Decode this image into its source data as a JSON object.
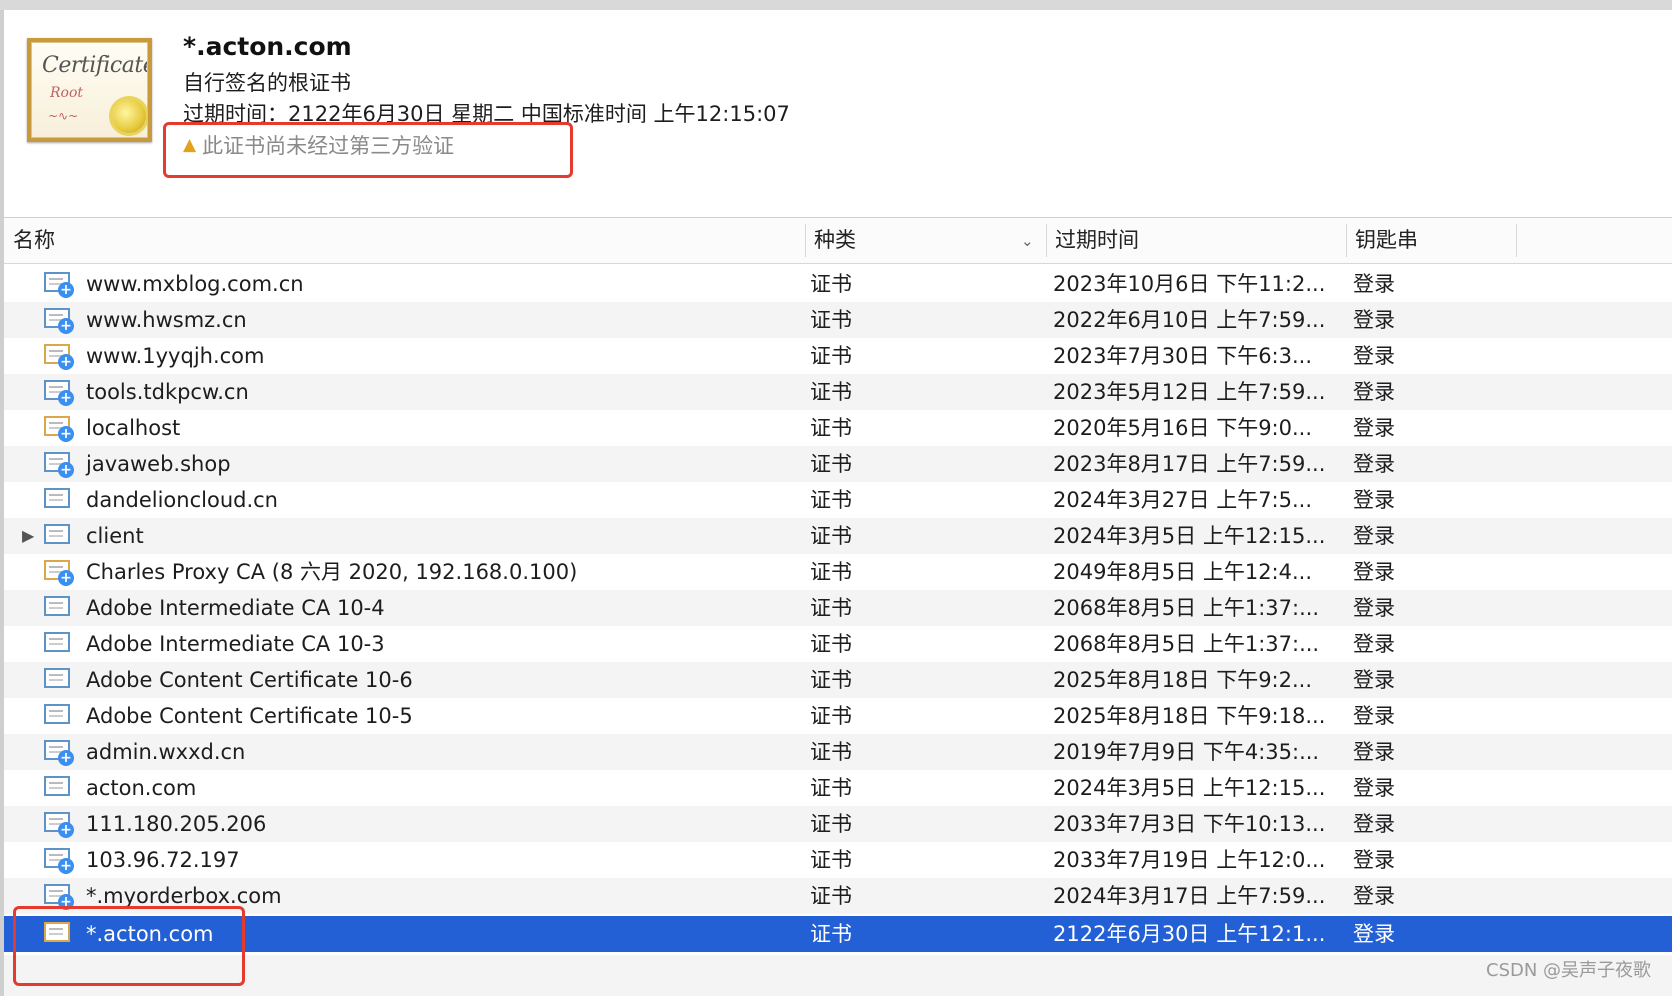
{
  "header": {
    "title": "*.acton.com",
    "subtitle": "自行签名的根证书",
    "expiry": "过期时间：2122年6月30日 星期二 中国标准时间 上午12:15:07",
    "warning": "此证书尚未经过第三方验证",
    "icon_text1": "Certificate",
    "icon_text2": "Root"
  },
  "columns": {
    "name": "名称",
    "kind": "种类",
    "expires": "过期时间",
    "keychain": "钥匙串"
  },
  "rows": [
    {
      "name": "www.mxblog.com.cn",
      "kind": "证书",
      "expires": "2023年10月6日 下午11:2...",
      "keychain": "登录"
    },
    {
      "name": "www.hwsmz.cn",
      "kind": "证书",
      "expires": "2022年6月10日 上午7:59...",
      "keychain": "登录"
    },
    {
      "name": "www.1yyqjh.com",
      "kind": "证书",
      "expires": "2023年7月30日 下午6:3...",
      "keychain": "登录"
    },
    {
      "name": "tools.tdkpcw.cn",
      "kind": "证书",
      "expires": "2023年5月12日 上午7:59...",
      "keychain": "登录"
    },
    {
      "name": "localhost",
      "kind": "证书",
      "expires": "2020年5月16日 下午9:0...",
      "keychain": "登录"
    },
    {
      "name": "javaweb.shop",
      "kind": "证书",
      "expires": "2023年8月17日 上午7:59...",
      "keychain": "登录"
    },
    {
      "name": "dandelioncloud.cn",
      "kind": "证书",
      "expires": "2024年3月27日 上午7:5...",
      "keychain": "登录"
    },
    {
      "name": "client",
      "kind": "证书",
      "expires": "2024年3月5日 上午12:15...",
      "keychain": "登录"
    },
    {
      "name": "Charles Proxy CA (8 六月 2020, 192.168.0.100)",
      "kind": "证书",
      "expires": "2049年8月5日 上午12:4...",
      "keychain": "登录"
    },
    {
      "name": "Adobe Intermediate CA 10-4",
      "kind": "证书",
      "expires": "2068年8月5日 上午1:37:...",
      "keychain": "登录"
    },
    {
      "name": "Adobe Intermediate CA 10-3",
      "kind": "证书",
      "expires": "2068年8月5日 上午1:37:...",
      "keychain": "登录"
    },
    {
      "name": "Adobe Content Certificate 10-6",
      "kind": "证书",
      "expires": "2025年8月18日 下午9:2...",
      "keychain": "登录"
    },
    {
      "name": "Adobe Content Certificate 10-5",
      "kind": "证书",
      "expires": "2025年8月18日 下午9:18...",
      "keychain": "登录"
    },
    {
      "name": "admin.wxxd.cn",
      "kind": "证书",
      "expires": "2019年7月9日 下午4:35:...",
      "keychain": "登录"
    },
    {
      "name": "acton.com",
      "kind": "证书",
      "expires": "2024年3月5日 上午12:15...",
      "keychain": "登录"
    },
    {
      "name": "111.180.205.206",
      "kind": "证书",
      "expires": "2033年7月3日 下午10:13...",
      "keychain": "登录"
    },
    {
      "name": "103.96.72.197",
      "kind": "证书",
      "expires": "2033年7月19日 上午12:0...",
      "keychain": "登录"
    },
    {
      "name": "*.myorderbox.com",
      "kind": "证书",
      "expires": "2024年3月17日 上午7:59...",
      "keychain": "登录"
    },
    {
      "name": "*.acton.com",
      "kind": "证书",
      "expires": "2122年6月30日 上午12:1...",
      "keychain": "登录"
    }
  ],
  "selected_row_index": 18,
  "colors": {
    "selection": "#2360d6",
    "highlight_box": "#e53b2f",
    "warning_icon": "#e2a21a"
  },
  "watermark": "CSDN @吴声子夜歌"
}
